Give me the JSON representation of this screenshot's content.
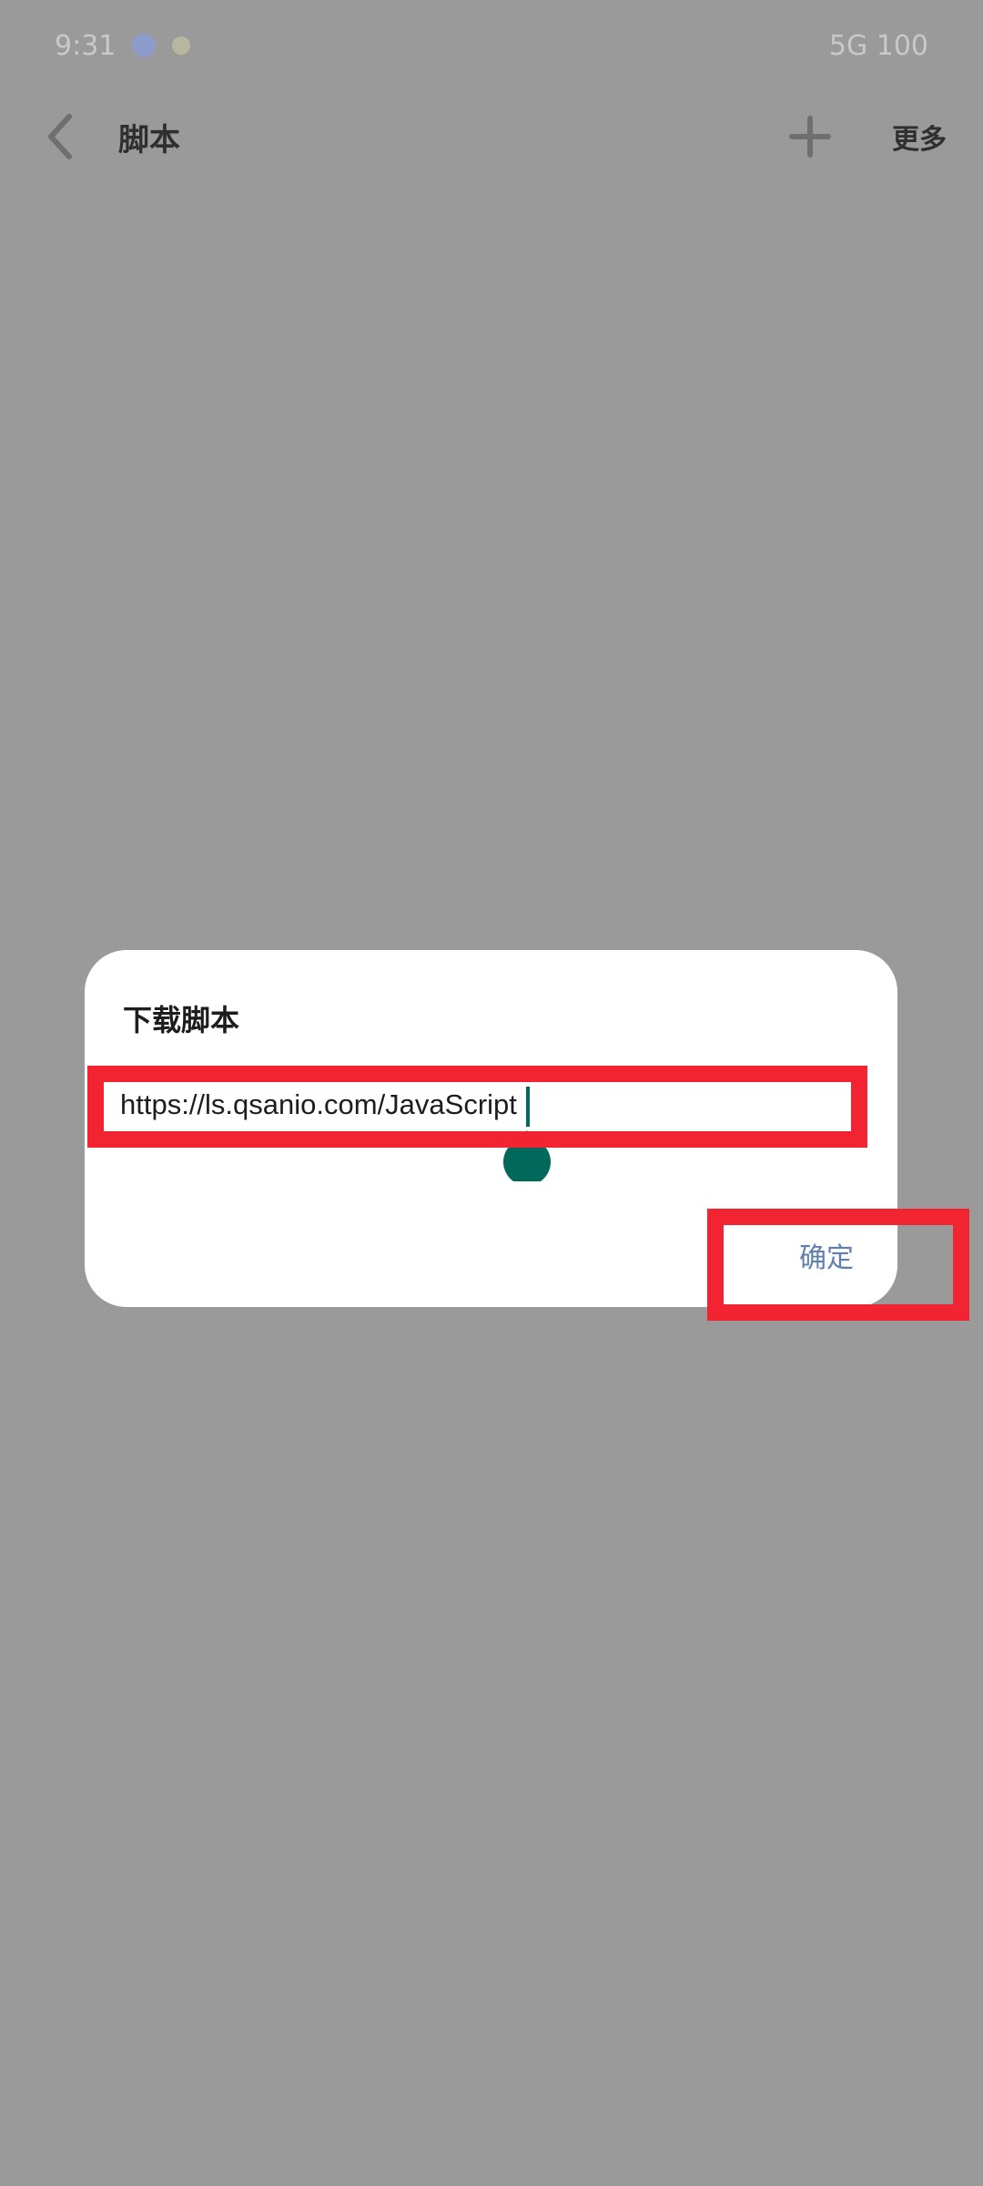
{
  "status_bar": {
    "time": "9:31",
    "right_text": "5G 100"
  },
  "top_bar": {
    "title": "脚本",
    "action_label": "更多"
  },
  "dialog": {
    "title": "下载脚本",
    "url_value": "https://ls.qsanio.com/JavaScript",
    "confirm_label": "确定"
  },
  "colors": {
    "overlay": "#9a9a9a",
    "dialog_bg": "#ffffff",
    "accent_cursor": "#00695c",
    "confirm_text": "#5f7fb0",
    "highlight": "#f22432"
  }
}
